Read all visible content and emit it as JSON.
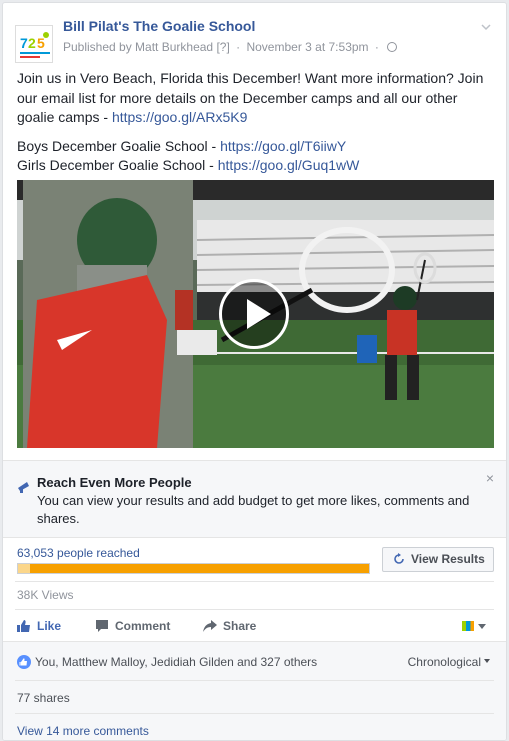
{
  "post": {
    "page_name": "Bill Pilat's The Goalie School",
    "published_by": "Published by Matt Burkhead",
    "help_marker": "[?]",
    "date": "November 3 at 7:53pm",
    "text_para1": "Join us in Vero Beach, Florida this December! Want more information? Join our email list for more details on the December camps and all our other goalie camps - ",
    "link1": "https://goo.gl/ARx5K9",
    "boys_label": "Boys December Goalie School - ",
    "boys_link": "https://goo.gl/T6iiwY",
    "girls_label": "Girls December Goalie School - ",
    "girls_link": "https://goo.gl/Guq1wW",
    "icons": [
      "avatar-logo",
      "chevron-down-icon",
      "globe-icon",
      "play-icon"
    ]
  },
  "boost": {
    "title": "Reach Even More People",
    "body": "You can view your results and add budget to get more likes, comments and shares.",
    "close": "×",
    "icon": "megaphone-icon"
  },
  "reach": {
    "label": "63,053 people reached",
    "progress": 1.0,
    "button_label": "View Results",
    "button_icon": "refresh-icon"
  },
  "stats": {
    "views": "38K Views"
  },
  "actions": {
    "like": "Like",
    "comment": "Comment",
    "share": "Share"
  },
  "engagement": {
    "likers": "You, Matthew Malloy, Jedidiah Gilden and 327 others",
    "order": "Chronological",
    "shares": "77 shares",
    "more_comments": "View 14 more comments"
  },
  "colors": {
    "link": "#365899",
    "reach_bar": "#f7a000",
    "like_blue": "#4267b2"
  }
}
